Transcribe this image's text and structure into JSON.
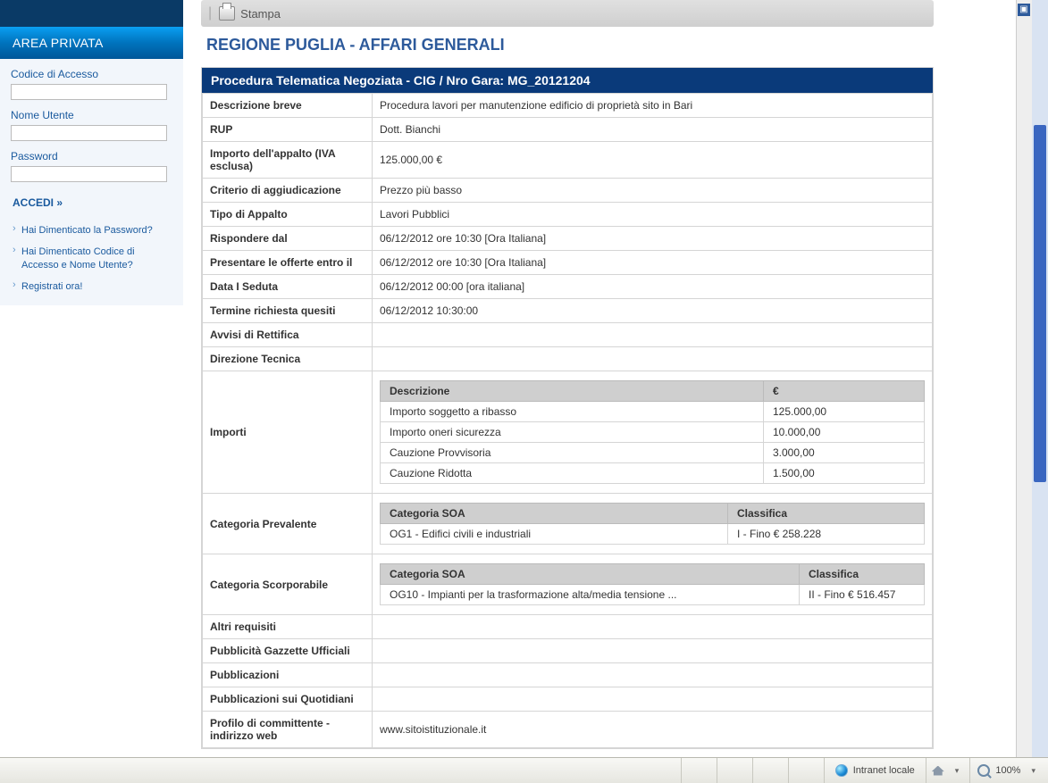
{
  "sidebar": {
    "title": "AREA PRIVATA",
    "code_label": "Codice di Accesso",
    "user_label": "Nome Utente",
    "pass_label": "Password",
    "login_label": "ACCEDI »",
    "links": [
      "Hai Dimenticato la Password?",
      "Hai Dimenticato Codice di Accesso e Nome Utente?",
      "Registrati ora!"
    ]
  },
  "toolbar": {
    "print_label": "Stampa"
  },
  "page": {
    "title": "REGIONE PUGLIA - AFFARI GENERALI",
    "panel_header": "Procedura Telematica Negoziata - CIG / Nro Gara: MG_20121204"
  },
  "rows": {
    "descrizione_label": "Descrizione breve",
    "descrizione_value": "Procedura lavori per manutenzione edificio di proprietà sito in Bari",
    "rup_label": "RUP",
    "rup_value": "Dott. Bianchi",
    "importo_label": "Importo dell'appalto (IVA esclusa)",
    "importo_value": "125.000,00 €",
    "criterio_label": "Criterio di aggiudicazione",
    "criterio_value": "Prezzo più basso",
    "tipo_label": "Tipo di Appalto",
    "tipo_value": "Lavori Pubblici",
    "rispondere_label": "Rispondere dal",
    "rispondere_value": "06/12/2012 ore 10:30 [Ora Italiana]",
    "presentare_label": "Presentare le offerte entro il",
    "presentare_value": "06/12/2012 ore 10:30 [Ora Italiana]",
    "seduta_label": "Data I Seduta",
    "seduta_value": "06/12/2012 00:00 [ora italiana]",
    "quesiti_label": "Termine richiesta quesiti",
    "quesiti_value": "06/12/2012 10:30:00",
    "avvisi_label": "Avvisi di Rettifica",
    "direzione_label": "Direzione Tecnica",
    "importi_label": "Importi",
    "prevalente_label": "Categoria Prevalente",
    "scorporabile_label": "Categoria Scorporabile",
    "altri_label": "Altri requisiti",
    "gazzette_label": "Pubblicità Gazzette Ufficiali",
    "pubblicazioni_label": "Pubblicazioni",
    "quotidiani_label": "Pubblicazioni sui Quotidiani",
    "profilo_label": "Profilo di committente - indirizzo web",
    "profilo_value": "www.sitoistituzionale.it"
  },
  "importi_table": {
    "h1": "Descrizione",
    "h2": "€",
    "r1d": "Importo soggetto a ribasso",
    "r1v": "125.000,00",
    "r2d": "Importo oneri sicurezza",
    "r2v": "10.000,00",
    "r3d": "Cauzione Provvisoria",
    "r3v": "3.000,00",
    "r4d": "Cauzione Ridotta",
    "r4v": "1.500,00"
  },
  "prevalente_table": {
    "h1": "Categoria SOA",
    "h2": "Classifica",
    "r1a": "OG1 - Edifici civili e industriali",
    "r1b": "I - Fino € 258.228"
  },
  "scorporabile_table": {
    "h1": "Categoria SOA",
    "h2": "Classifica",
    "r1a": "OG10 - Impianti per la trasformazione alta/media tensione ...",
    "r1b": "II - Fino € 516.457"
  },
  "statusbar": {
    "zone": "Intranet locale",
    "zoom": "100%"
  }
}
